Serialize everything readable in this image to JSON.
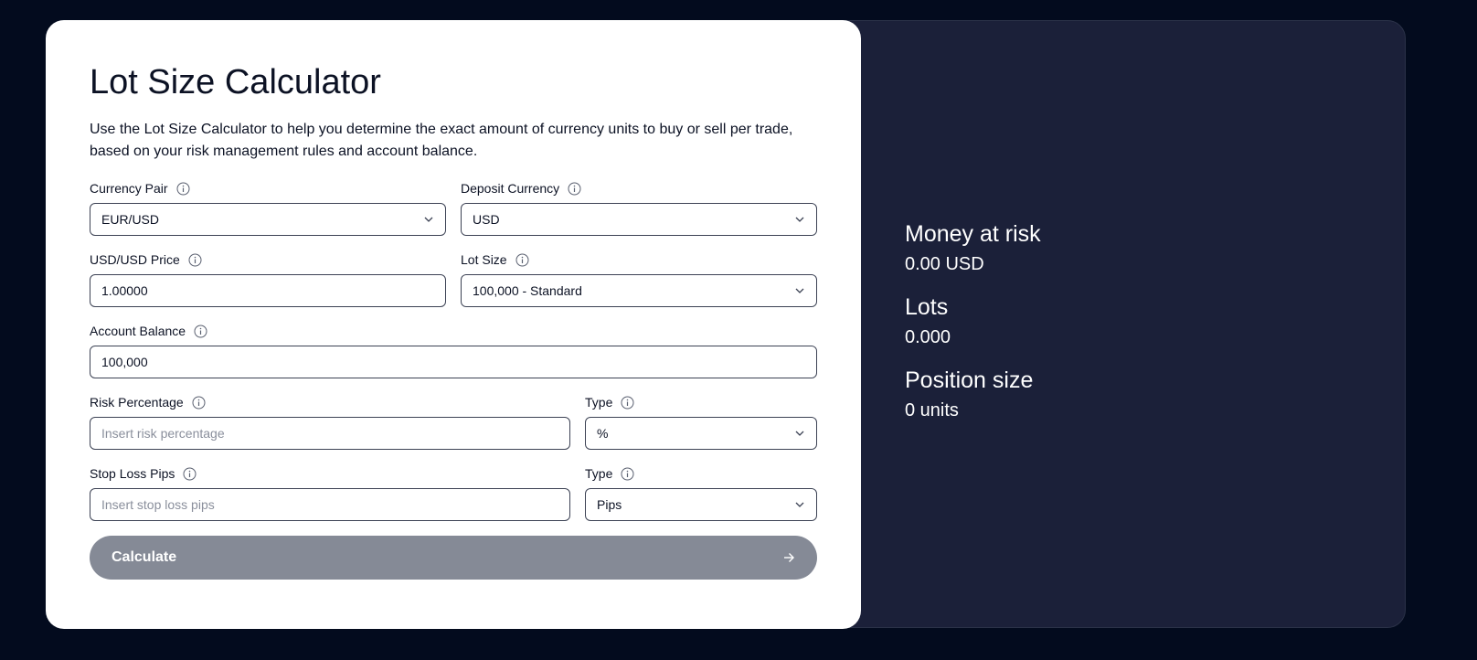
{
  "title": "Lot Size Calculator",
  "description": "Use the Lot Size Calculator to help you determine the exact amount of currency units to buy or sell per trade, based on your risk management rules and account balance.",
  "fields": {
    "currency_pair": {
      "label": "Currency Pair",
      "value": "EUR/USD"
    },
    "deposit_currency": {
      "label": "Deposit Currency",
      "value": "USD"
    },
    "price": {
      "label": "USD/USD Price",
      "value": "1.00000"
    },
    "lot_size": {
      "label": "Lot Size",
      "value": "100,000 - Standard"
    },
    "account_balance": {
      "label": "Account Balance",
      "value": "100,000"
    },
    "risk_percentage": {
      "label": "Risk Percentage",
      "placeholder": "Insert risk percentage"
    },
    "risk_type": {
      "label": "Type",
      "value": "%"
    },
    "stop_loss": {
      "label": "Stop Loss Pips",
      "placeholder": "Insert stop loss pips"
    },
    "stop_type": {
      "label": "Type",
      "value": "Pips"
    }
  },
  "calculate_label": "Calculate",
  "results": {
    "money_at_risk": {
      "label": "Money at risk",
      "value": "0.00 USD"
    },
    "lots": {
      "label": "Lots",
      "value": "0.000"
    },
    "position_size": {
      "label": "Position size",
      "value": "0 units"
    }
  },
  "icons": {
    "info": "info-icon",
    "chevron": "chevron-down-icon",
    "arrow": "arrow-right-icon"
  },
  "colors": {
    "page_bg": "#030b1e",
    "panel_bg": "#1b2039",
    "button_bg": "#858a96"
  }
}
